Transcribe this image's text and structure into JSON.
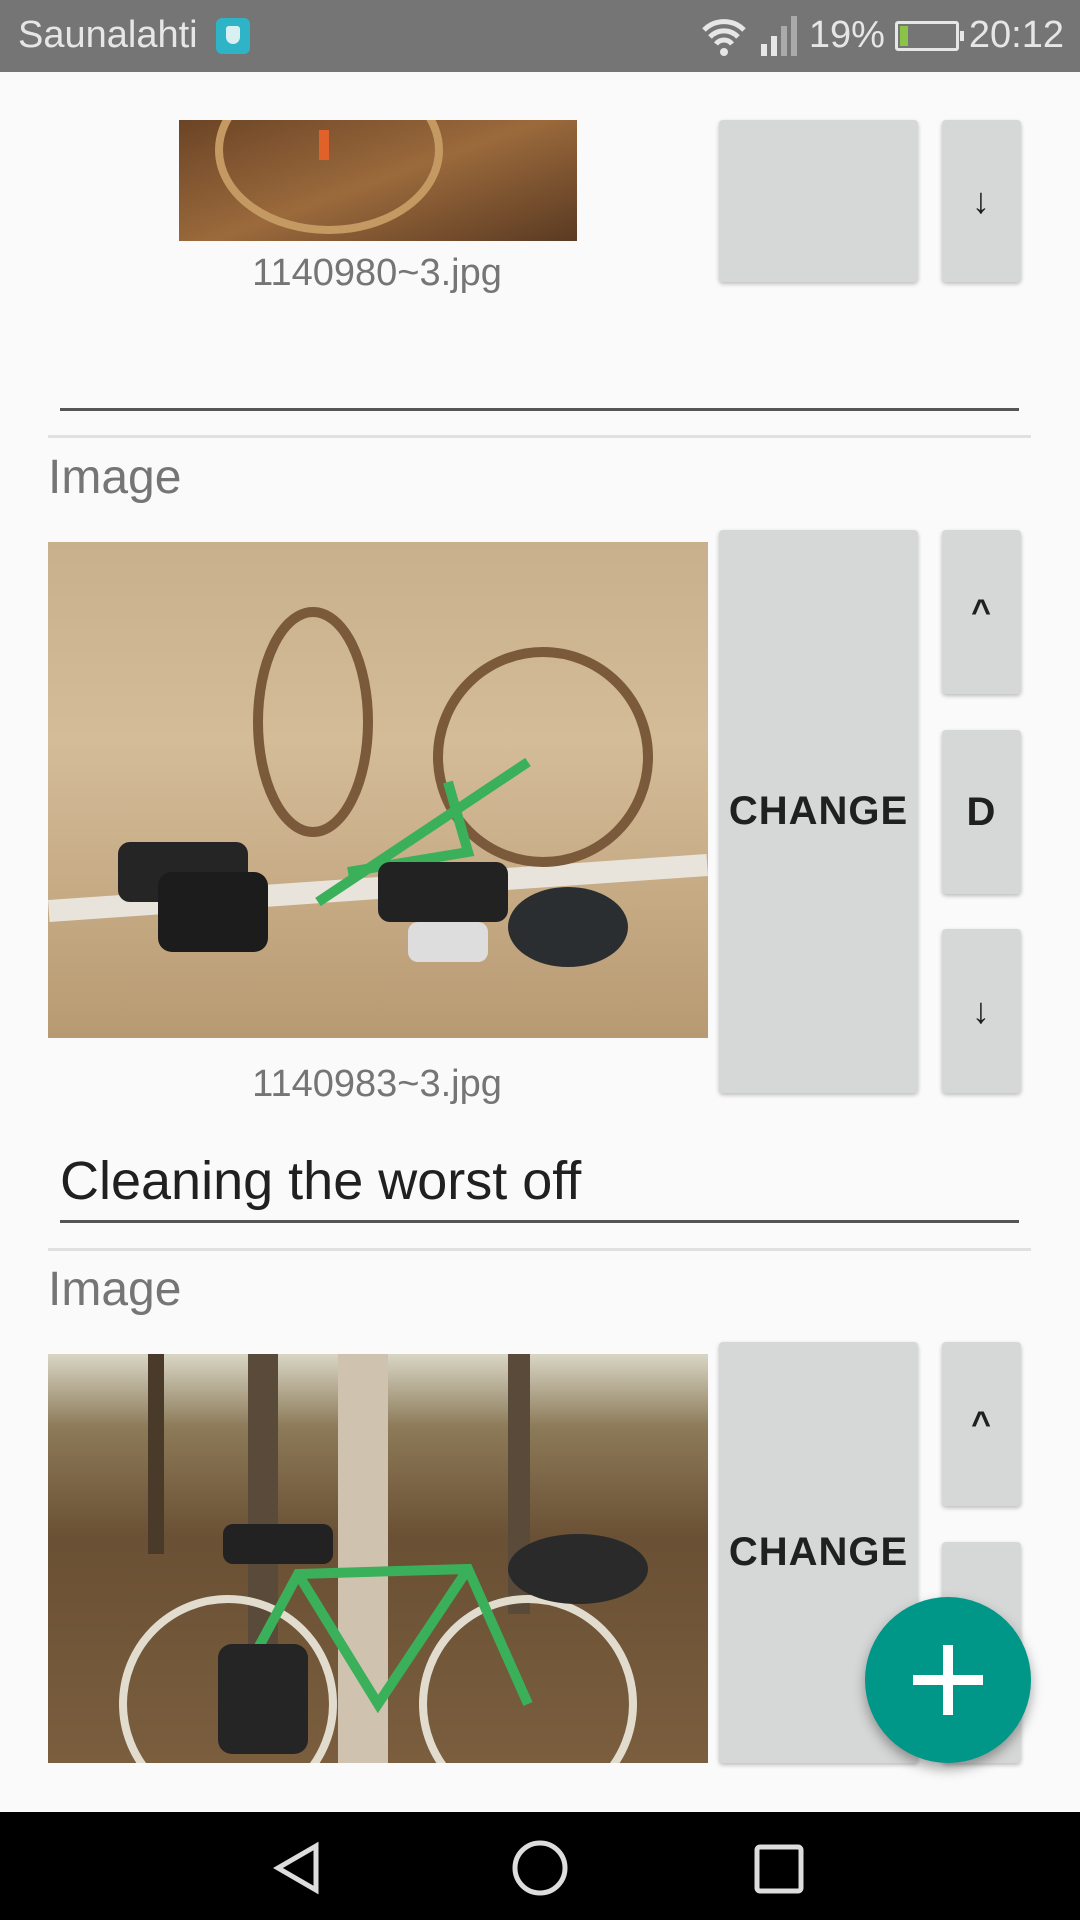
{
  "status_bar": {
    "carrier": "Saunalahti",
    "battery": "19%",
    "time": "20:12"
  },
  "items": [
    {
      "filename": "1140980~3.jpg",
      "caption": "",
      "down": "↓"
    },
    {
      "label": "Image",
      "filename": "1140983~3.jpg",
      "change": "CHANGE",
      "up": "^",
      "delete": "D",
      "down": "↓",
      "caption": "Cleaning the worst off"
    },
    {
      "label": "Image",
      "change": "CHANGE",
      "up": "^"
    }
  ],
  "fab": {
    "icon": "plus-icon"
  },
  "colors": {
    "accent": "#009688",
    "button": "#d6d7d7"
  }
}
